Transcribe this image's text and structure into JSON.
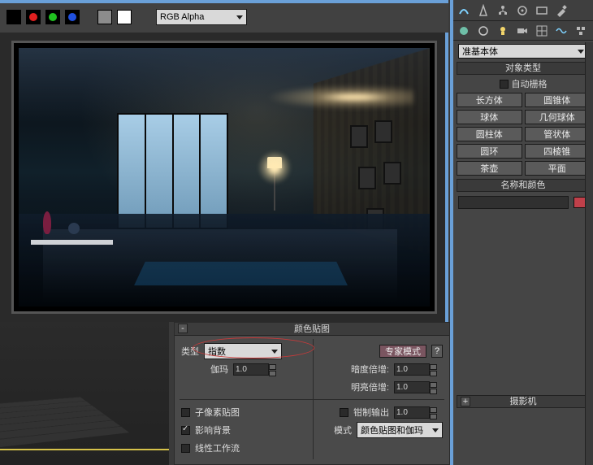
{
  "topbar": {
    "channel_dropdown": "RGB Alpha"
  },
  "rollout": {
    "title": "颜色贴图",
    "type_label": "类型",
    "type_value": "指数",
    "gamma_label": "伽玛",
    "gamma_value": "1.0",
    "expert_button": "专家模式",
    "qmark": "?",
    "dark_mult_label": "暗度倍增:",
    "dark_mult_value": "1.0",
    "bright_mult_label": "明亮倍增:",
    "bright_mult_value": "1.0",
    "subpixel_label": "子像素贴图",
    "affect_bg_label": "影响背景",
    "linear_wf_label": "线性工作流",
    "clamp_label": "钳制输出",
    "clamp_value": "1.0",
    "mode_label": "模式",
    "mode_value": "颜色贴图和伽玛"
  },
  "rpanel": {
    "category_value": "准基本体",
    "section_object_type": "对象类型",
    "autogrid_label": "自动栅格",
    "primitives": [
      [
        "长方体",
        "圆锥体"
      ],
      [
        "球体",
        "几何球体"
      ],
      [
        "圆柱体",
        "管状体"
      ],
      [
        "圆环",
        "四棱锥"
      ],
      [
        "茶壶",
        "平面"
      ]
    ],
    "section_name_color": "名称和颜色",
    "section_camera": "摄影机"
  }
}
